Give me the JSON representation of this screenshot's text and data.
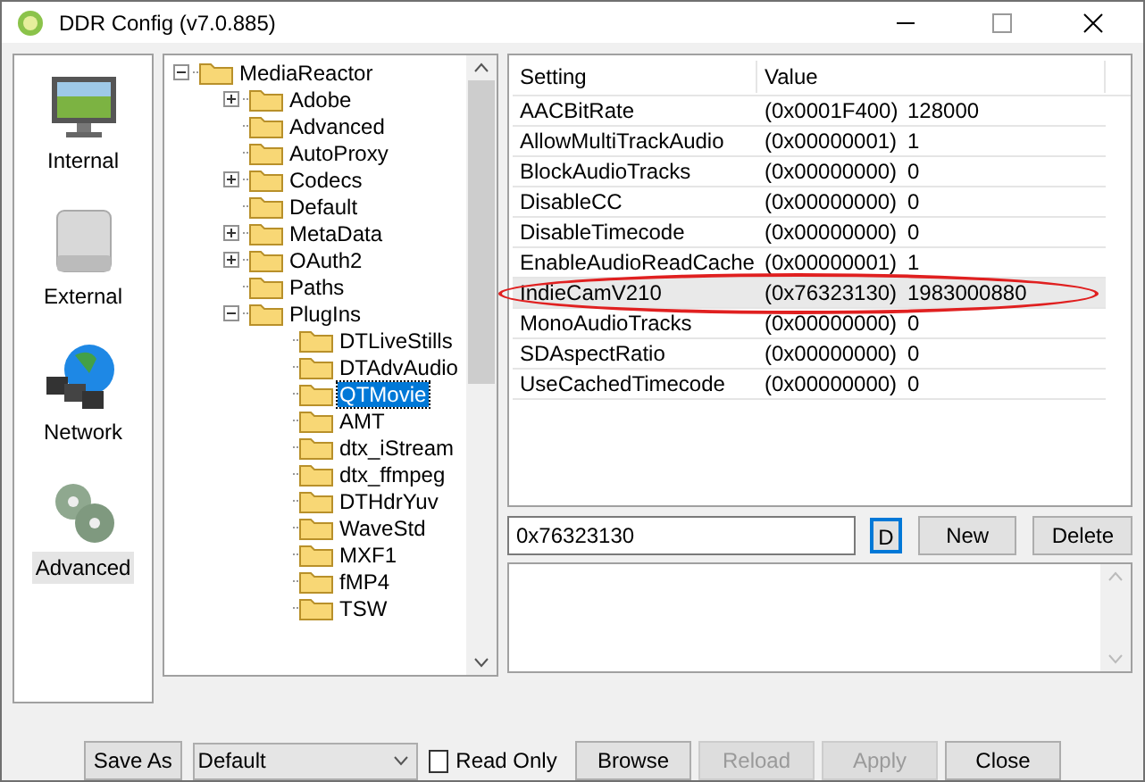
{
  "window": {
    "title": "DDR Config (v7.0.885)"
  },
  "sidebar": {
    "items": [
      {
        "label": "Internal",
        "selected": false,
        "kind": "monitor"
      },
      {
        "label": "External",
        "selected": false,
        "kind": "drive"
      },
      {
        "label": "Network",
        "selected": false,
        "kind": "network"
      },
      {
        "label": "Advanced",
        "selected": true,
        "kind": "gears"
      }
    ]
  },
  "tree": [
    {
      "label": "MediaReactor",
      "expanded": true,
      "selected": false,
      "children": [
        {
          "label": "Adobe",
          "expanded": false,
          "selected": false
        },
        {
          "label": "Advanced",
          "selected": false
        },
        {
          "label": "AutoProxy",
          "selected": false
        },
        {
          "label": "Codecs",
          "expanded": false,
          "selected": false
        },
        {
          "label": "Default",
          "selected": false
        },
        {
          "label": "MetaData",
          "expanded": false,
          "selected": false
        },
        {
          "label": "OAuth2",
          "expanded": false,
          "selected": false
        },
        {
          "label": "Paths",
          "selected": false
        },
        {
          "label": "PlugIns",
          "expanded": true,
          "selected": false,
          "children": [
            {
              "label": "DTLiveStills",
              "selected": false
            },
            {
              "label": "DTAdvAudio",
              "selected": false
            },
            {
              "label": "QTMovie",
              "selected": true
            },
            {
              "label": "AMT",
              "selected": false
            },
            {
              "label": "dtx_iStream",
              "selected": false
            },
            {
              "label": "dtx_ffmpeg",
              "selected": false
            },
            {
              "label": "DTHdrYuv",
              "selected": false
            },
            {
              "label": "WaveStd",
              "selected": false
            },
            {
              "label": "MXF1",
              "selected": false
            },
            {
              "label": "fMP4",
              "selected": false
            },
            {
              "label": "TSW",
              "selected": false
            }
          ]
        }
      ]
    }
  ],
  "table": {
    "columns": [
      "Setting",
      "Value"
    ],
    "rows": [
      {
        "setting": "AACBitRate",
        "hex": "(0x0001F400)",
        "value": "128000",
        "selected": false,
        "circled": false
      },
      {
        "setting": "AllowMultiTrackAudio",
        "hex": "(0x00000001)",
        "value": "1",
        "selected": false,
        "circled": false
      },
      {
        "setting": "BlockAudioTracks",
        "hex": "(0x00000000)",
        "value": "0",
        "selected": false,
        "circled": false
      },
      {
        "setting": "DisableCC",
        "hex": "(0x00000000)",
        "value": "0",
        "selected": false,
        "circled": false
      },
      {
        "setting": "DisableTimecode",
        "hex": "(0x00000000)",
        "value": "0",
        "selected": false,
        "circled": false
      },
      {
        "setting": "EnableAudioReadCache",
        "hex": "(0x00000001)",
        "value": "1",
        "selected": false,
        "circled": false
      },
      {
        "setting": "IndieCamV210",
        "hex": "(0x76323130)",
        "value": "1983000880",
        "selected": true,
        "circled": true
      },
      {
        "setting": "MonoAudioTracks",
        "hex": "(0x00000000)",
        "value": "0",
        "selected": false,
        "circled": false
      },
      {
        "setting": "SDAspectRatio",
        "hex": "(0x00000000)",
        "value": "0",
        "selected": false,
        "circled": false
      },
      {
        "setting": "UseCachedTimecode",
        "hex": "(0x00000000)",
        "value": "0",
        "selected": false,
        "circled": false
      }
    ]
  },
  "editor": {
    "value": "0x76323130",
    "d_button": {
      "label": "D",
      "focused": true
    },
    "buttons": [
      {
        "label": "New",
        "disabled": false
      },
      {
        "label": "Delete",
        "disabled": false
      }
    ]
  },
  "footer": {
    "save_as": "Save As",
    "profile": "Default",
    "read_only": {
      "label": "Read Only",
      "checked": false
    },
    "buttons": [
      {
        "label": "Browse",
        "disabled": false
      },
      {
        "label": "Reload",
        "disabled": true
      },
      {
        "label": "Apply",
        "disabled": true
      },
      {
        "label": "Close",
        "disabled": false
      }
    ]
  }
}
